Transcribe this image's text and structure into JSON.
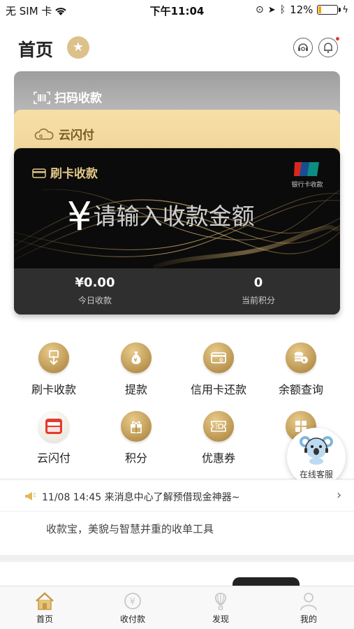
{
  "status_bar": {
    "carrier": "无 SIM 卡",
    "time": "下午11:04",
    "battery_text": "12%",
    "battery_level": 0.12,
    "battery_color": "#f2a600"
  },
  "header": {
    "title": "首页",
    "icons": [
      "star-icon",
      "customer-service-icon",
      "bell-icon"
    ]
  },
  "cards": {
    "scan_label": "扫码收款",
    "quickpass_label": "云闪付",
    "main": {
      "label": "刷卡收款",
      "badge_text": "银行卡收款",
      "currency_symbol": "¥",
      "amount_placeholder": "请输入收款金额",
      "stats": [
        {
          "value": "¥0.00",
          "label": "今日收款"
        },
        {
          "value": "0",
          "label": "当前积分"
        }
      ]
    }
  },
  "grid": {
    "items": [
      {
        "label": "刷卡收款",
        "icon": "card-down-icon"
      },
      {
        "label": "提款",
        "icon": "money-bag-icon"
      },
      {
        "label": "信用卡还款",
        "icon": "credit-card-icon"
      },
      {
        "label": "余额查询",
        "icon": "coins-icon"
      },
      {
        "label": "云闪付",
        "icon": "quickpass-icon"
      },
      {
        "label": "积分",
        "icon": "gift-icon"
      },
      {
        "label": "优惠券",
        "icon": "coupon-icon"
      },
      {
        "label": "",
        "icon": "apps-icon"
      }
    ]
  },
  "float_service": {
    "label": "在线客服"
  },
  "news": {
    "text": "11/08 14:45 来消息中心了解预借现金神器~"
  },
  "slogan": "收款宝，美貌与智慧并重的收单工具",
  "tabbar": {
    "items": [
      {
        "label": "首页",
        "active": true
      },
      {
        "label": "收付款",
        "active": false
      },
      {
        "label": "发现",
        "active": false
      },
      {
        "label": "我的",
        "active": false
      }
    ]
  },
  "colors": {
    "gold": "#e3c786",
    "accent": "#dcc18a",
    "card_dark": "#0b0b0b"
  }
}
